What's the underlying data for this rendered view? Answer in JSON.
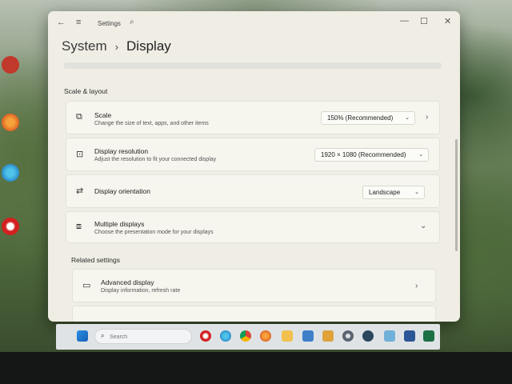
{
  "window": {
    "app_title": "Settings",
    "breadcrumb_parent": "System",
    "breadcrumb_separator": "›",
    "breadcrumb_current": "Display"
  },
  "scale_layout": {
    "section_title": "Scale & layout",
    "scale": {
      "title": "Scale",
      "desc": "Change the size of text, apps, and other items",
      "value": "150% (Recommended)"
    },
    "resolution": {
      "title": "Display resolution",
      "desc": "Adjust the resolution to fit your connected display",
      "value": "1920 × 1080 (Recommended)"
    },
    "orientation": {
      "title": "Display orientation",
      "value": "Landscape"
    },
    "multiple": {
      "title": "Multiple displays",
      "desc": "Choose the presentation mode for your displays"
    }
  },
  "related": {
    "section_title": "Related settings",
    "advanced": {
      "title": "Advanced display",
      "desc": "Display information, refresh rate"
    }
  },
  "taskbar": {
    "search_placeholder": "Search"
  },
  "icons": {
    "back": "back-arrow-icon",
    "menu": "hamburger-menu-icon",
    "search": "search-icon",
    "scale": "scale-icon",
    "resolution": "resolution-icon",
    "orientation": "orientation-icon",
    "multiple": "multiple-displays-icon",
    "advanced": "monitor-icon"
  },
  "colors": {
    "window_bg": "#efede4",
    "card_bg": "#f6f5ee",
    "taskbar_bg": "#dfe3e6"
  }
}
